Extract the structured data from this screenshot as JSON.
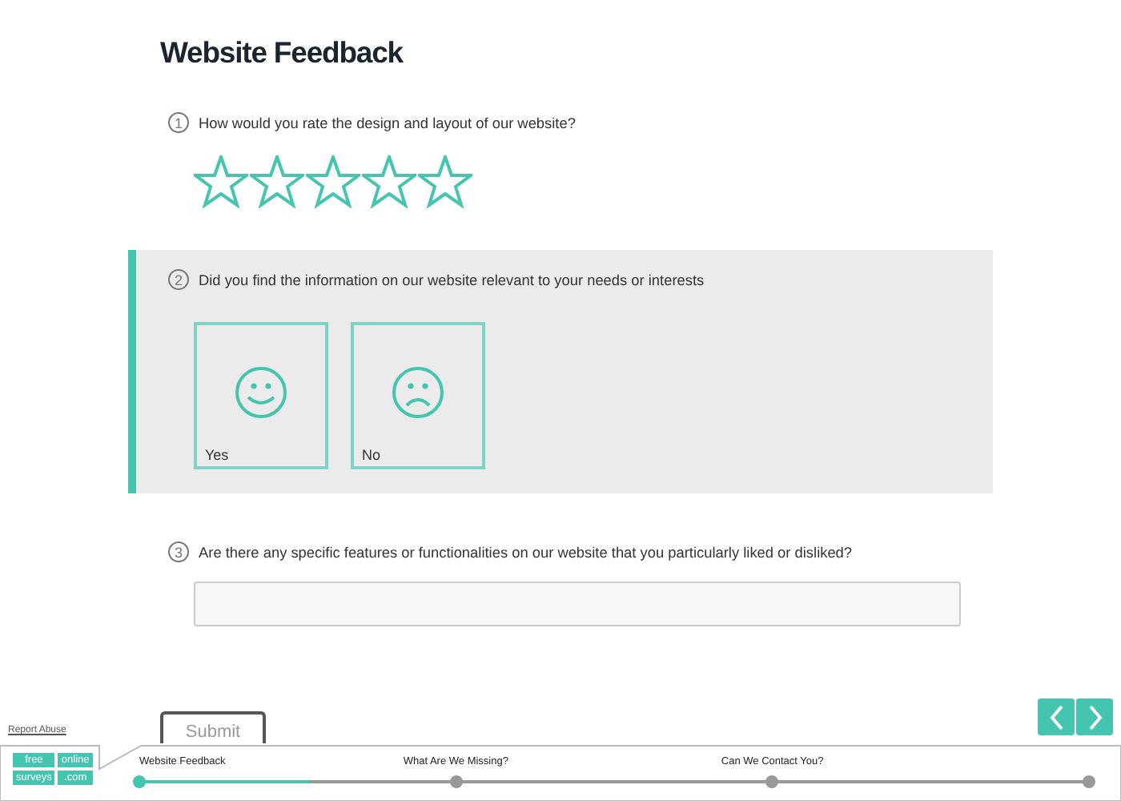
{
  "title": "Website Feedback",
  "questions": [
    {
      "number": "1",
      "text": "How would you rate the design and layout of our website?",
      "kind": "rating",
      "active": false,
      "stars": 0
    },
    {
      "number": "2",
      "text": "Did you find the information on our website relevant to your needs or interests",
      "kind": "choice",
      "active": true,
      "options": [
        {
          "label": "Yes",
          "kind": "smile",
          "selected": false
        },
        {
          "label": "No",
          "kind": "frown",
          "selected": false
        }
      ]
    },
    {
      "number": "3",
      "text": "Are there any specific features or functionalities on our website that you particularly liked or disliked?",
      "kind": "text",
      "active": false
    }
  ],
  "submit": "Submit",
  "report_abuse": "Report Abuse",
  "logo": [
    "free",
    "online",
    "surveys",
    ".com"
  ],
  "progress": {
    "level": 0.18,
    "steps": [
      {
        "label": "Website Feedback",
        "reached": true
      },
      {
        "label": "What Are We Missing?",
        "reached": false
      },
      {
        "label": "Can We Contact You?",
        "reached": false
      },
      {
        "reached": false
      }
    ]
  }
}
